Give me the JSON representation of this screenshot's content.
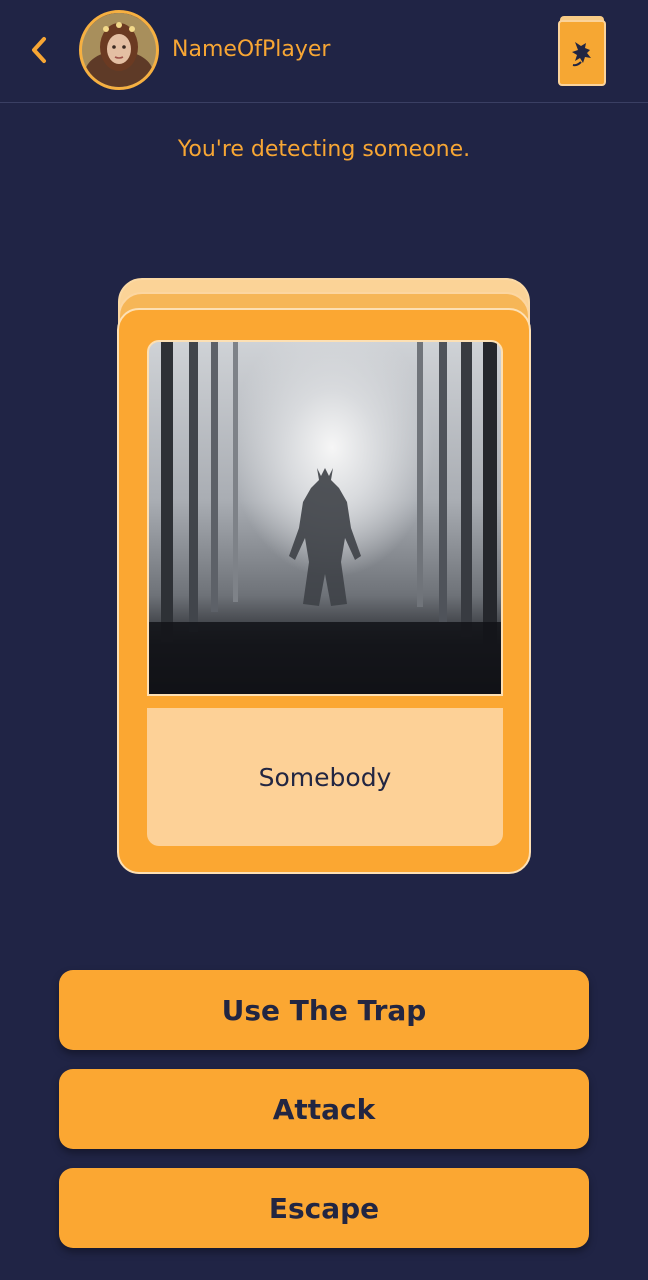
{
  "header": {
    "player_name": "NameOfPlayer",
    "back_icon": "chevron-left-icon",
    "deck_icon": "dragon-card-deck-icon"
  },
  "status": "You're detecting someone.",
  "card": {
    "name": "Somebody",
    "image": "shadowy-creature-in-misty-forest"
  },
  "actions": {
    "use_trap": "Use The Trap",
    "attack": "Attack",
    "escape": "Escape"
  },
  "colors": {
    "background": "#202445",
    "accent": "#fba732",
    "accent_light": "#fdd197",
    "text_dark": "#222642"
  }
}
